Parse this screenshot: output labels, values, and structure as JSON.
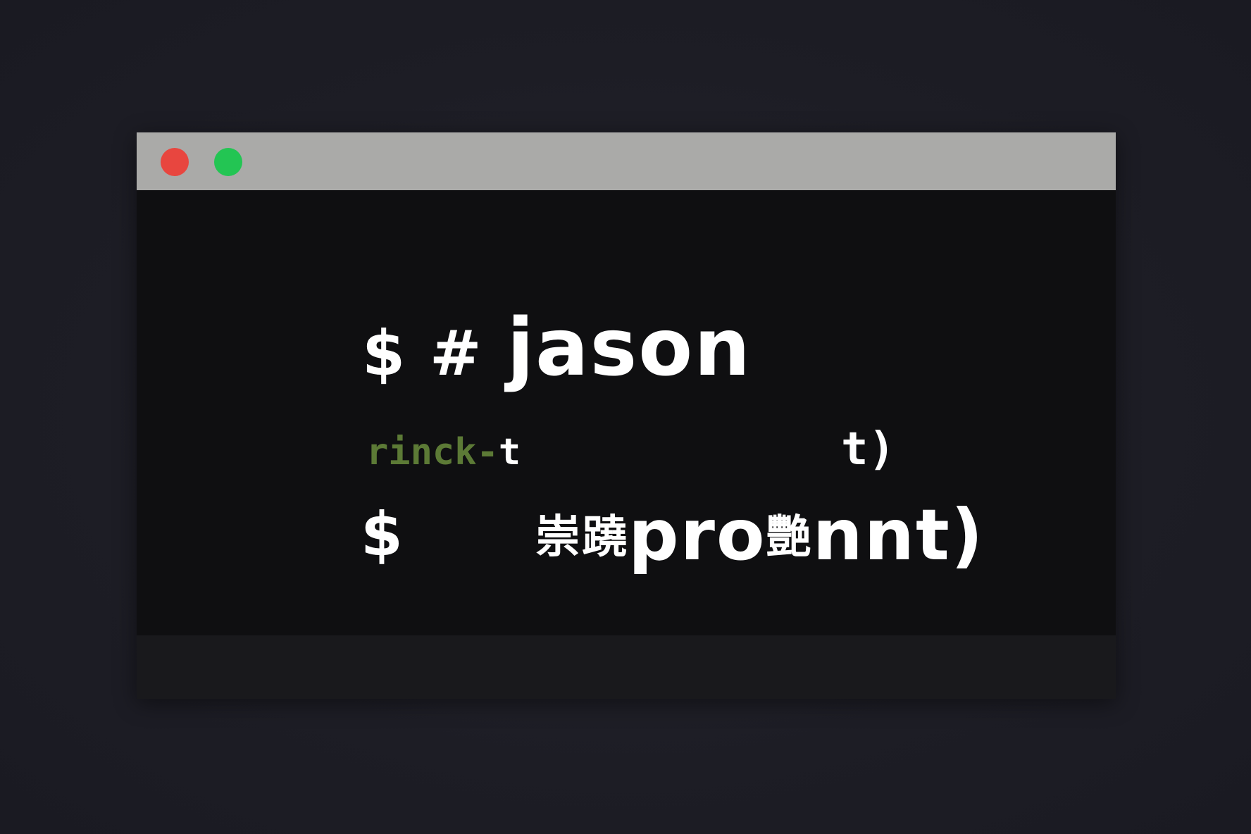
{
  "window": {
    "buttons": [
      {
        "name": "close",
        "color": "#e8463f"
      },
      {
        "name": "maximize",
        "color": "#23c553"
      }
    ]
  },
  "terminal": {
    "line1": {
      "symbols": "$ #",
      "command": "jason"
    },
    "line2": {
      "green_text": "rinck-",
      "white_text": "t",
      "right_text": "t)"
    },
    "line3": {
      "prompt": "$",
      "cjk_prefix": "崇蹺",
      "word": "pro",
      "cjk_mid": "艷",
      "tail": "nnt)"
    }
  },
  "colors": {
    "background": "#1e1e26",
    "titlebar": "#aaaaa8",
    "terminal_bg": "#0f0f11",
    "green_text": "#5c7a36",
    "foreground": "#ffffff"
  }
}
